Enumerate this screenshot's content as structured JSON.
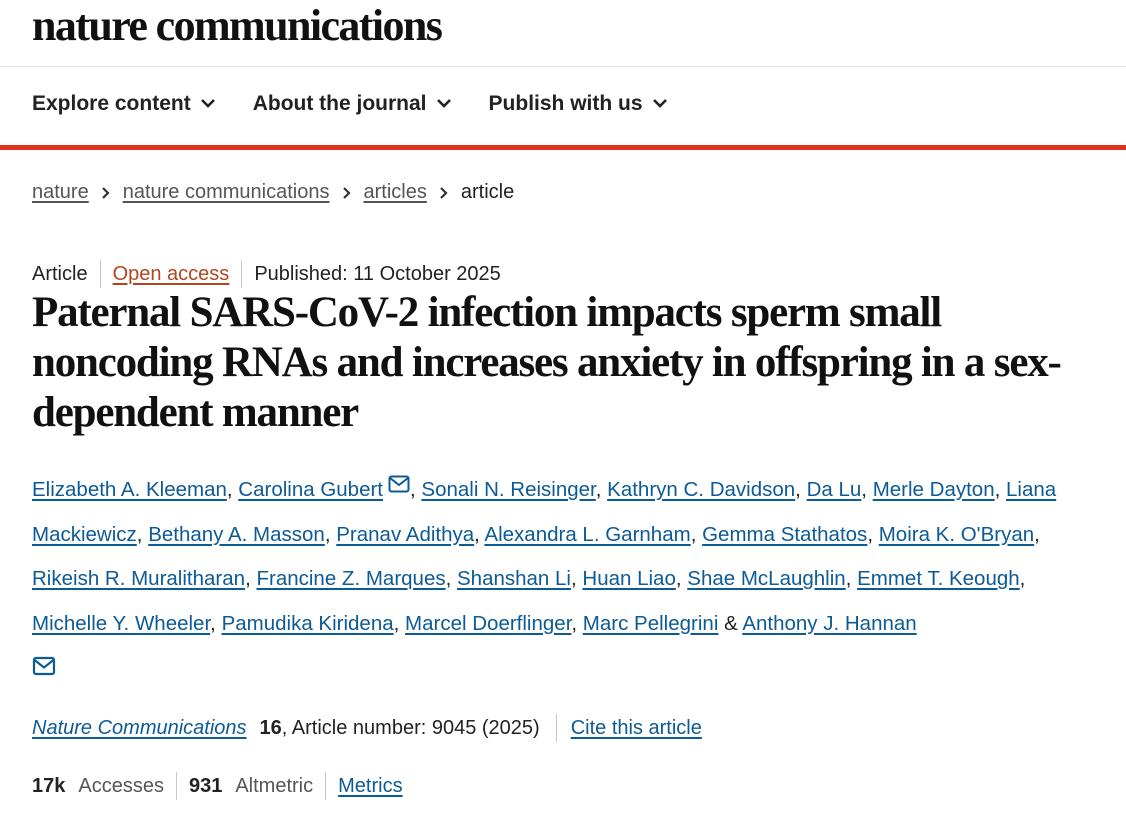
{
  "header": {
    "logo": "nature communications",
    "nav": [
      {
        "label": "Explore content"
      },
      {
        "label": "About the journal"
      },
      {
        "label": "Publish with us"
      }
    ]
  },
  "breadcrumb": {
    "items": [
      "nature",
      "nature communications",
      "articles"
    ],
    "current": "article"
  },
  "article": {
    "type": "Article",
    "access": "Open access",
    "published": "Published: 11 October 2025",
    "title": "Paternal SARS-CoV-2 infection impacts sperm small noncoding RNAs and increases anxiety in offspring in a sex-dependent manner",
    "authors": [
      "Elizabeth A. Kleeman",
      "Carolina Gubert",
      "Sonali N. Reisinger",
      "Kathryn C. Davidson",
      "Da Lu",
      "Merle Dayton",
      "Liana Mackiewicz",
      "Bethany A. Masson",
      "Pranav Adithya",
      "Alexandra L. Garnham",
      "Gemma Stathatos",
      "Moira K. O'Bryan",
      "Rikeish R. Muralitharan",
      "Francine Z. Marques",
      "Shanshan Li",
      "Huan Liao",
      "Shae McLaughlin",
      "Emmet T. Keough",
      "Michelle Y. Wheeler",
      "Pamudika Kiridena",
      "Marcel Doerflinger",
      "Marc Pellegrini",
      "Anthony J. Hannan"
    ],
    "journal": "Nature Communications",
    "volume": "16",
    "article_number": ", Article number: 9045 (2025)",
    "cite_label": "Cite this article",
    "metrics": {
      "accesses_value": "17k",
      "accesses_label": "Accesses",
      "altmetric_value": "931",
      "altmetric_label": "Altmetric",
      "metrics_link": "Metrics"
    }
  },
  "colors": {
    "accent_bar": "#e0301e",
    "link": "#0c5a96",
    "open_access": "#b4441f"
  },
  "icons": {
    "nav_chevron": "chevron-down-icon",
    "crumb_separator": "chevron-right-icon",
    "corresponding_author": "envelope-icon"
  }
}
